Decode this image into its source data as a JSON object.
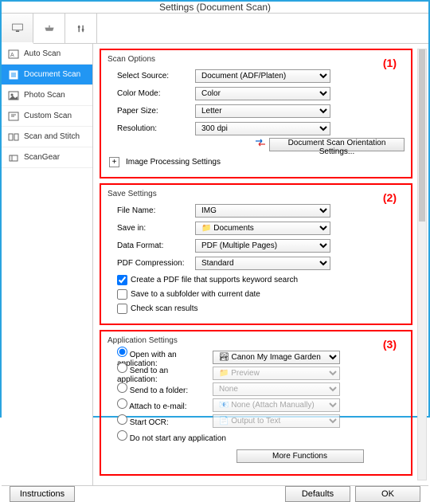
{
  "title": "Settings (Document Scan)",
  "sidebar": {
    "items": [
      {
        "label": "Auto Scan",
        "active": false
      },
      {
        "label": "Document Scan",
        "active": true
      },
      {
        "label": "Photo Scan",
        "active": false
      },
      {
        "label": "Custom Scan",
        "active": false
      },
      {
        "label": "Scan and Stitch",
        "active": false
      },
      {
        "label": "ScanGear",
        "active": false
      }
    ]
  },
  "groups": {
    "scan_options": {
      "num": "(1)",
      "title": "Scan Options",
      "select_source_label": "Select Source:",
      "select_source_value": "Document (ADF/Platen)",
      "color_mode_label": "Color Mode:",
      "color_mode_value": "Color",
      "paper_size_label": "Paper Size:",
      "paper_size_value": "Letter",
      "resolution_label": "Resolution:",
      "resolution_value": "300 dpi",
      "orientation_btn": "Document Scan Orientation Settings...",
      "image_proc": "Image Processing Settings"
    },
    "save_settings": {
      "num": "(2)",
      "title": "Save Settings",
      "file_name_label": "File Name:",
      "file_name_value": "IMG",
      "save_in_label": "Save in:",
      "save_in_value": "Documents",
      "data_format_label": "Data Format:",
      "data_format_value": "PDF (Multiple Pages)",
      "pdf_comp_label": "PDF Compression:",
      "pdf_comp_value": "Standard",
      "chk_keyword": "Create a PDF file that supports keyword search",
      "chk_subfolder": "Save to a subfolder with current date",
      "chk_results": "Check scan results"
    },
    "app_settings": {
      "num": "(3)",
      "title": "Application Settings",
      "open_app_label": "Open with an application:",
      "open_app_value": "Canon My Image Garden",
      "send_app_label": "Send to an application:",
      "send_app_value": "Preview",
      "send_folder_label": "Send to a folder:",
      "send_folder_value": "None",
      "attach_email_label": "Attach to e-mail:",
      "attach_email_value": "None (Attach Manually)",
      "start_ocr_label": "Start OCR:",
      "start_ocr_value": "Output to Text",
      "do_not_start": "Do not start any application",
      "more_functions": "More Functions"
    }
  },
  "footer": {
    "instructions": "Instructions",
    "defaults": "Defaults",
    "ok": "OK"
  }
}
